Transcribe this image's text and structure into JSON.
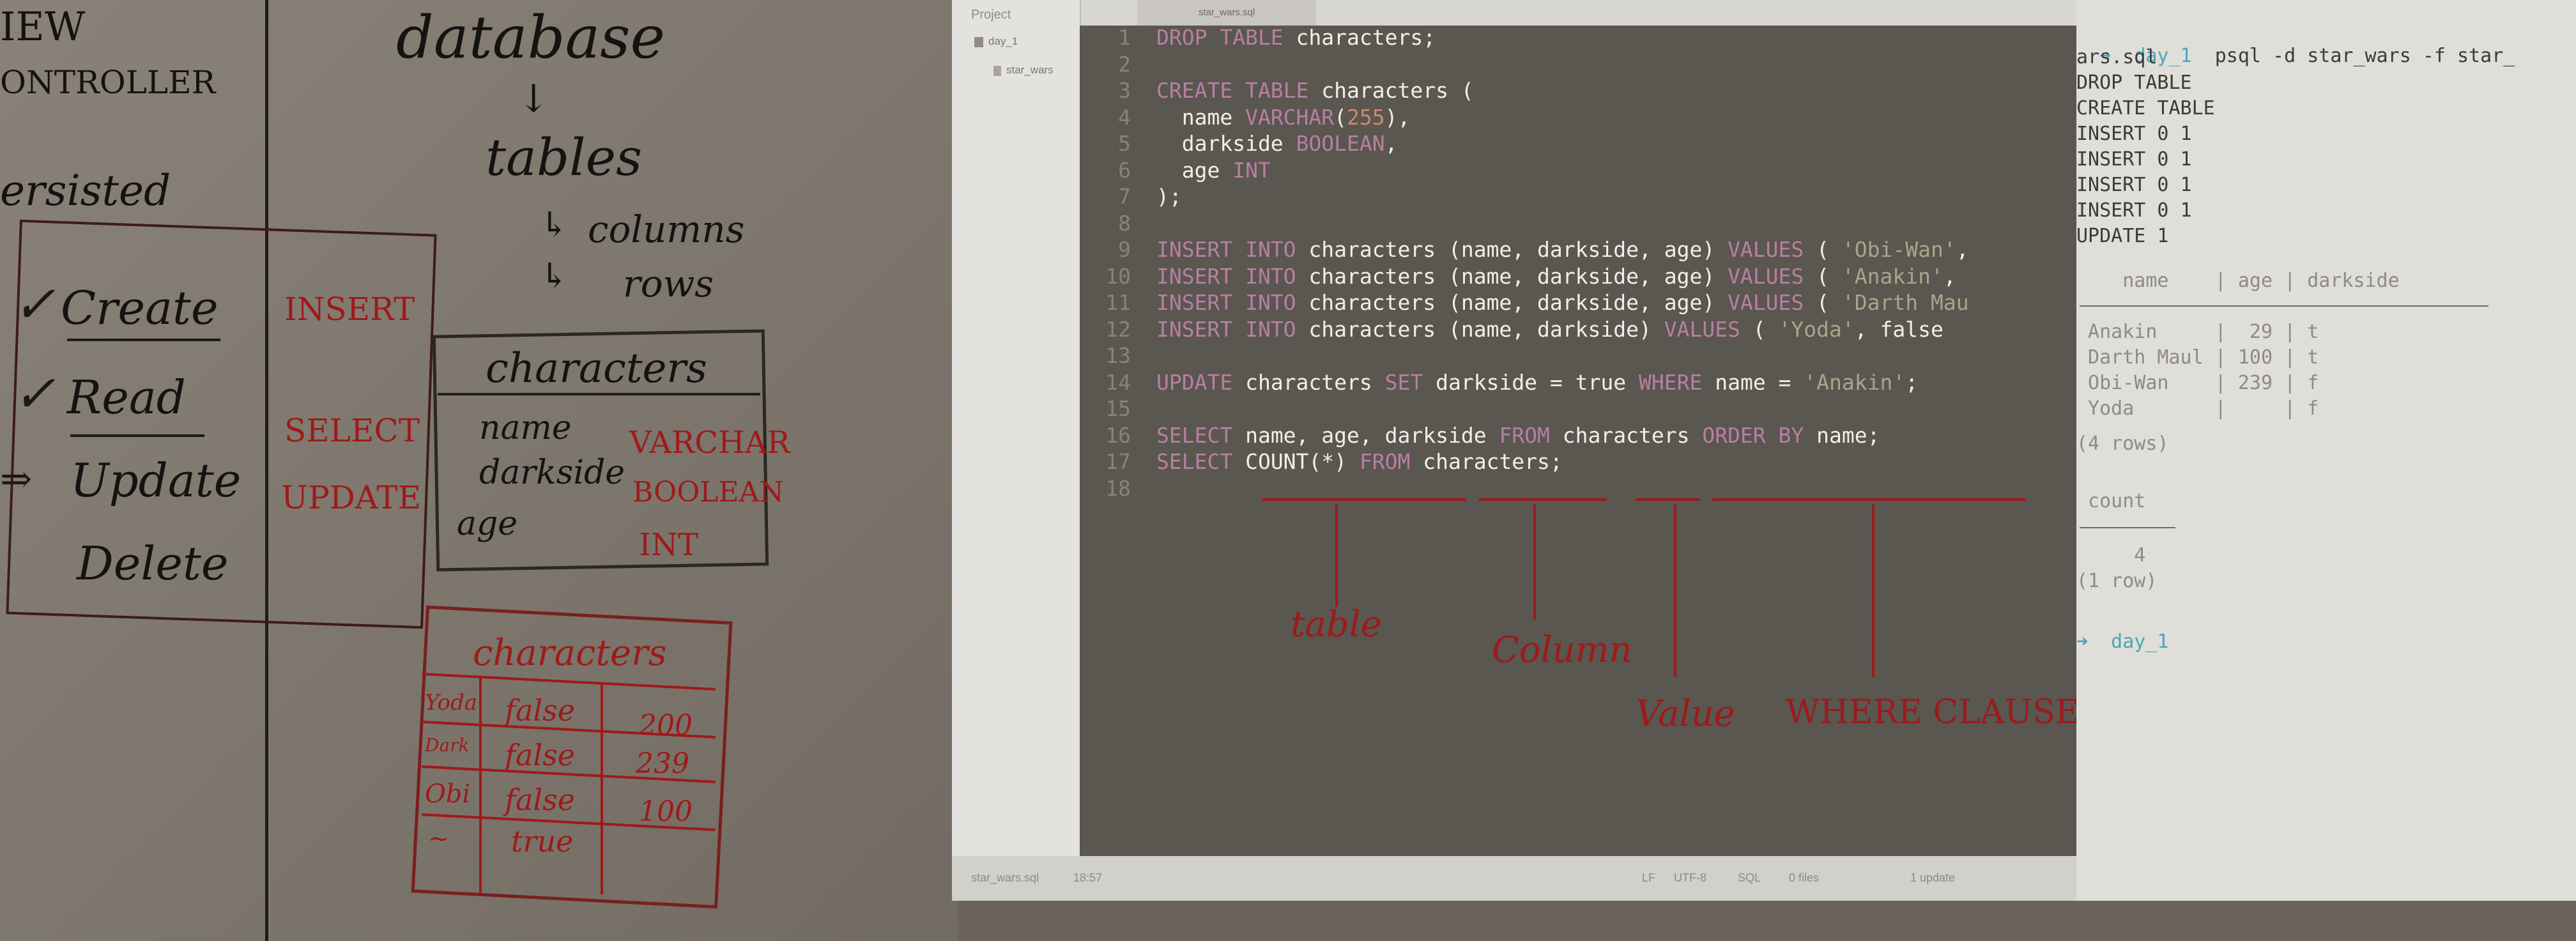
{
  "whiteboard": {
    "crud_title_lines": [
      "IEW",
      "ONTROLLER"
    ],
    "persisted_label": "ersisted",
    "crud": [
      {
        "check": "✓",
        "word": "Create",
        "sql": "INSERT"
      },
      {
        "check": "✓",
        "word": "Read",
        "sql": "SELECT"
      },
      {
        "check": "⇒",
        "word": "Update",
        "sql": "UPDATE"
      },
      {
        "check": "",
        "word": "Delete",
        "sql": ""
      }
    ],
    "hierarchy": {
      "database": "database",
      "tables": "tables",
      "columns": "columns",
      "rows": "rows"
    },
    "schema_table": {
      "title": "characters",
      "rows": [
        {
          "name": "name",
          "type": "VARCHAR"
        },
        {
          "name": "darkside",
          "type": "BOOLEAN"
        },
        {
          "name": "age",
          "type": "INT"
        }
      ]
    },
    "data_table": {
      "title": "characters",
      "rows": [
        [
          "Yoda",
          "false",
          "200"
        ],
        [
          "Dark",
          "false",
          "239"
        ],
        [
          "Obi",
          "false",
          "100"
        ],
        [
          "~",
          "true",
          ""
        ]
      ]
    },
    "annotations": [
      "table",
      "Column",
      "Value",
      "WHERE CLAUSE"
    ]
  },
  "editor": {
    "sidebar_header": "Project",
    "tree": [
      "day_1",
      "star_wars"
    ],
    "tab_label": "star_wars.sql",
    "lines": [
      {
        "n": "1",
        "parts": [
          [
            "kw",
            "DROP TABLE "
          ],
          [
            "plain",
            "characters;"
          ]
        ]
      },
      {
        "n": "2",
        "parts": []
      },
      {
        "n": "3",
        "parts": [
          [
            "kw",
            "CREATE TABLE "
          ],
          [
            "plain",
            "characters ("
          ]
        ]
      },
      {
        "n": "4",
        "parts": [
          [
            "plain",
            "  name "
          ],
          [
            "kw",
            "VARCHAR"
          ],
          [
            "plain",
            "("
          ],
          [
            "num",
            "255"
          ],
          [
            "plain",
            "),"
          ]
        ]
      },
      {
        "n": "5",
        "parts": [
          [
            "plain",
            "  darkside "
          ],
          [
            "kw",
            "BOOLEAN"
          ],
          [
            "plain",
            ","
          ]
        ]
      },
      {
        "n": "6",
        "parts": [
          [
            "plain",
            "  age "
          ],
          [
            "kw",
            "INT"
          ]
        ]
      },
      {
        "n": "7",
        "parts": [
          [
            "plain",
            ");"
          ]
        ]
      },
      {
        "n": "8",
        "parts": []
      },
      {
        "n": "9",
        "parts": [
          [
            "kw",
            "INSERT INTO "
          ],
          [
            "plain",
            "characters (name, darkside, age) "
          ],
          [
            "kw",
            "VALUES "
          ],
          [
            "plain",
            "( "
          ],
          [
            "str",
            "'Obi-Wan'"
          ],
          [
            "plain",
            ","
          ]
        ]
      },
      {
        "n": "10",
        "parts": [
          [
            "kw",
            "INSERT INTO "
          ],
          [
            "plain",
            "characters (name, darkside, age) "
          ],
          [
            "kw",
            "VALUES "
          ],
          [
            "plain",
            "( "
          ],
          [
            "str",
            "'Anakin'"
          ],
          [
            "plain",
            ","
          ]
        ]
      },
      {
        "n": "11",
        "parts": [
          [
            "kw",
            "INSERT INTO "
          ],
          [
            "plain",
            "characters (name, darkside, age) "
          ],
          [
            "kw",
            "VALUES "
          ],
          [
            "plain",
            "( "
          ],
          [
            "str",
            "'Darth Mau"
          ]
        ]
      },
      {
        "n": "12",
        "parts": [
          [
            "kw",
            "INSERT INTO "
          ],
          [
            "plain",
            "characters (name, darkside) "
          ],
          [
            "kw",
            "VALUES "
          ],
          [
            "plain",
            "( "
          ],
          [
            "str",
            "'Yoda'"
          ],
          [
            "plain",
            ", false"
          ]
        ]
      },
      {
        "n": "13",
        "parts": []
      },
      {
        "n": "14",
        "parts": [
          [
            "kw",
            "UPDATE "
          ],
          [
            "plain",
            "characters "
          ],
          [
            "kw",
            "SET "
          ],
          [
            "plain",
            "darkside = true "
          ],
          [
            "kw",
            "WHERE "
          ],
          [
            "plain",
            "name = "
          ],
          [
            "str",
            "'Anakin'"
          ],
          [
            "plain",
            ";"
          ]
        ]
      },
      {
        "n": "15",
        "parts": []
      },
      {
        "n": "16",
        "parts": [
          [
            "kw",
            "SELECT "
          ],
          [
            "plain",
            "name, age, darkside "
          ],
          [
            "kw",
            "FROM "
          ],
          [
            "plain",
            "characters "
          ],
          [
            "kw",
            "ORDER BY "
          ],
          [
            "plain",
            "name;"
          ]
        ]
      },
      {
        "n": "17",
        "parts": [
          [
            "kw",
            "SELECT "
          ],
          [
            "plain",
            "COUNT(*) "
          ],
          [
            "kw",
            "FROM "
          ],
          [
            "plain",
            "characters;"
          ]
        ]
      },
      {
        "n": "18",
        "parts": []
      }
    ],
    "status": {
      "file": "star_wars.sql",
      "position": "18:57",
      "line_ending": "LF",
      "encoding": "UTF-8",
      "grammar": "SQL",
      "git": "0 files",
      "update": "1 update"
    }
  },
  "terminal": {
    "prompt_symbol": "➜",
    "prompt_dir": "day_1",
    "command": "psql -d star_wars -f star_",
    "command_cont": "ars.sql",
    "output": [
      "DROP TABLE",
      "CREATE TABLE",
      "INSERT 0 1",
      "INSERT 0 1",
      "INSERT 0 1",
      "INSERT 0 1",
      "UPDATE 1"
    ],
    "table1": {
      "header": "    name    | age | darkside",
      "rows": [
        " Anakin     |  29 | t",
        " Darth Maul | 100 | t",
        " Obi-Wan    | 239 | f",
        " Yoda       |     | f"
      ],
      "footer": "(4 rows)"
    },
    "table2": {
      "header": " count",
      "value": "     4",
      "footer": "(1 row)"
    },
    "final_prompt": "➜  day_1"
  }
}
